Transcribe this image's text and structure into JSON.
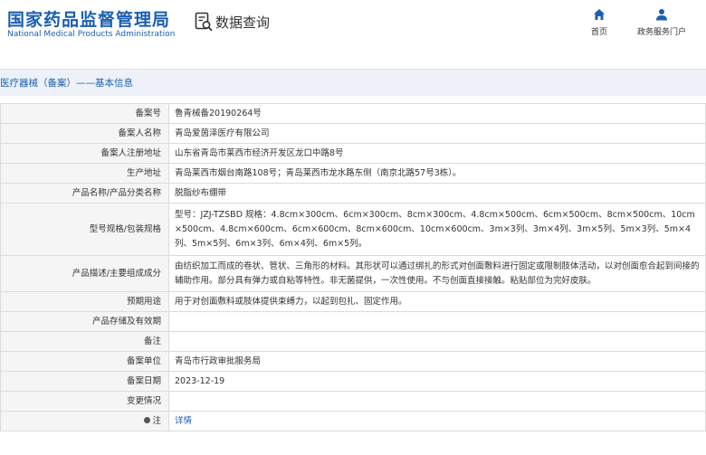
{
  "header": {
    "brand_cn": "国家药品监督管理局",
    "brand_en": "National Medical Products Administration",
    "query_label": "数据查询",
    "nav": [
      {
        "label": "首页",
        "icon": "home-icon"
      },
      {
        "label": "政务服务门户",
        "icon": "user-icon"
      }
    ]
  },
  "section": {
    "title": "医疗器械（备案）——基本信息"
  },
  "rows": [
    {
      "label": "备案号",
      "value": "鲁青械备20190264号"
    },
    {
      "label": "备案人名称",
      "value": "青岛爱茵泽医疗有限公司"
    },
    {
      "label": "备案人注册地址",
      "value": "山东省青岛市莱西市经济开发区龙口中路8号"
    },
    {
      "label": "生产地址",
      "value": "青岛莱西市烟台南路108号；青岛莱西市龙水路东侧（南京北路57号3栋）。"
    },
    {
      "label": "产品名称/产品分类名称",
      "value": "脱脂纱布绷带"
    },
    {
      "label": "型号规格/包装规格",
      "value": "型号：JZJ-TZSBD 规格：4.8cm×300cm、6cm×300cm、8cm×300cm、4.8cm×500cm、6cm×500cm、8cm×500cm、10cm×500cm、4.8cm×600cm、6cm×600cm、8cm×600cm、10cm×600cm、3m×3列、3m×4列、3m×5列、5m×3列、5m×4列、5m×5列、6m×3列、6m×4列、6m×5列。"
    },
    {
      "label": "产品描述/主要组成成分",
      "value": "由纺织加工而成的卷状、管状、三角形的材料。其形状可以通过绑扎的形式对创面敷料进行固定或限制肢体活动，以对创面愈合起到间接的辅助作用。部分具有弹力或自粘等特性。非无菌提供，一次性使用。不与创面直接接触。粘贴部位为完好皮肤。"
    },
    {
      "label": "预期用途",
      "value": "用于对创面敷料或肢体提供束缚力，以起到包扎、固定作用。"
    },
    {
      "label": "产品存储及有效期",
      "value": ""
    },
    {
      "label": "备注",
      "value": ""
    },
    {
      "label": "备案单位",
      "value": "青岛市行政审批服务局"
    },
    {
      "label": "备案日期",
      "value": "2023-12-19"
    },
    {
      "label": "变更情况",
      "value": ""
    }
  ],
  "note_row": {
    "label": "注",
    "link_text": "详情"
  },
  "colors": {
    "brand_blue": "#1b5fb0",
    "label_bg": "#f5f5f5",
    "border": "#dcdcdc",
    "section_bg": "#eef2f8"
  }
}
